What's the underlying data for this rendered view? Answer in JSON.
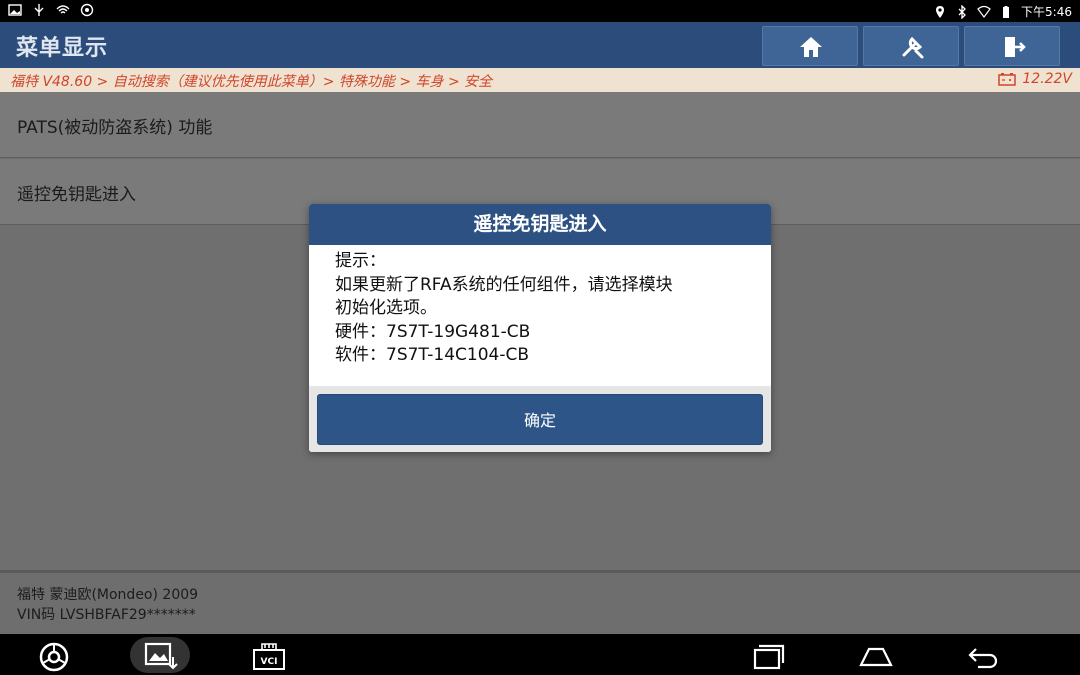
{
  "status_bar": {
    "time": "下午5:46"
  },
  "header": {
    "title": "菜单显示",
    "buttons": [
      {
        "icon": "home-icon"
      },
      {
        "icon": "tools-icon"
      },
      {
        "icon": "exit-icon"
      }
    ]
  },
  "breadcrumb": {
    "path": "福特 V48.60 > 自动搜索（建议优先使用此菜单）> 特殊功能 > 车身 > 安全",
    "voltage": "12.22V"
  },
  "menu": {
    "items": [
      {
        "label": "PATS(被动防盗系统) 功能"
      },
      {
        "label": "遥控免钥匙进入"
      }
    ]
  },
  "footer": {
    "vehicle": "福特 蒙迪欧(Mondeo) 2009",
    "vin": "VIN码 LVSHBFAF29*******"
  },
  "dialog": {
    "title": "遥控免钥匙进入",
    "lines": [
      "提示：",
      "如果更新了RFA系统的任何组件，请选择模块",
      "初始化选项。",
      "硬件：7S7T-19G481-CB",
      "软件：7S7T-14C104-CB"
    ],
    "ok_label": "确定"
  },
  "colors": {
    "header_bg": "#2c4d7b",
    "dialog_header": "#2d5182",
    "breadcrumb_text": "#d0452b"
  }
}
